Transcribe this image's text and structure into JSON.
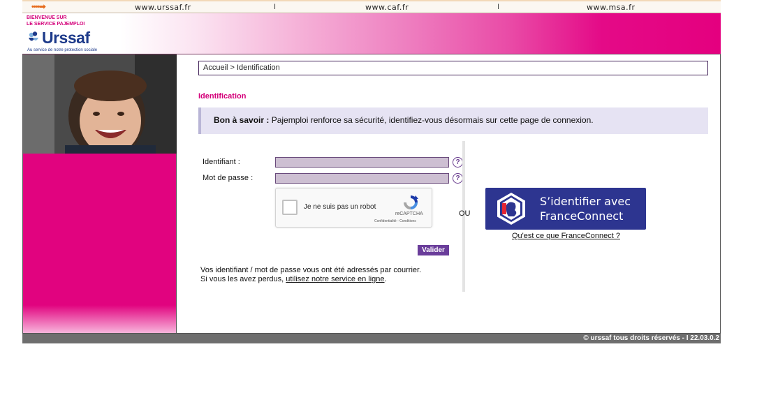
{
  "top_links": {
    "arrow": "••••➡",
    "urssaf": "www.urssaf.fr",
    "caf": "www.caf.fr",
    "msa": "www.msa.fr",
    "separator": "I"
  },
  "header": {
    "welcome_line1": "BIENVENUE SUR",
    "welcome_line2": "LE SERVICE PAJEMPLOI",
    "logo_word": "Urssaf",
    "logo_tagline": "Au service de notre protection sociale"
  },
  "breadcrumb": "Accueil > Identification",
  "page_title": "Identification",
  "info": {
    "bold": "Bon à savoir :",
    "text": " Pajemploi renforce sa sécurité, identifiez-vous désormais sur cette page de connexion."
  },
  "form": {
    "identifiant_label": "Identifiant :",
    "password_label": "Mot de passe :",
    "help_glyph": "?",
    "captcha_label": "Je ne suis pas un robot",
    "captcha_brand": "reCAPTCHA",
    "captcha_links": "Confidentialité - Conditions",
    "submit_label": "Valider"
  },
  "help_text": {
    "line1": "Vos identifiant / mot de passe vous ont été adressés par courrier.",
    "line2_prefix": "Si vous les avez perdus, ",
    "line2_link": "utilisez notre service en ligne",
    "line2_suffix": "."
  },
  "or_label": "OU",
  "franceconnect": {
    "line1": "S’identifier avec",
    "line2": "FranceConnect",
    "link": "Qu'est ce que FranceConnect ?",
    "bg_color": "#2d3590"
  },
  "footer": "© urssaf tous droits réservés - I 22.03.0.2",
  "colors": {
    "accent_pink": "#e4007f",
    "accent_purple": "#6a3d9a"
  }
}
